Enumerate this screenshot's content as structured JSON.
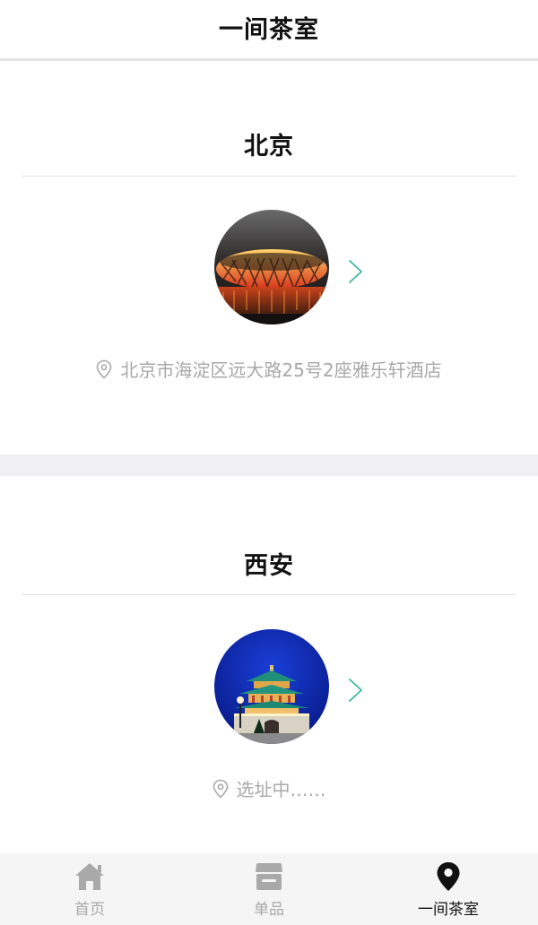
{
  "header": {
    "title": "一间茶室"
  },
  "locations": [
    {
      "city": "北京",
      "address": "北京市海淀区远大路25号2座雅乐轩酒店"
    },
    {
      "city": "西安",
      "address": "选址中……"
    }
  ],
  "tabbar": {
    "tabs": [
      {
        "label": "首页",
        "icon": "home-icon",
        "active": false
      },
      {
        "label": "单品",
        "icon": "shop-icon",
        "active": false
      },
      {
        "label": "一间茶室",
        "icon": "location-pin-icon",
        "active": true
      }
    ]
  },
  "colors": {
    "active_tab": "#111111",
    "inactive_tab": "#a9a9a9",
    "chevron": "#3fb8a0",
    "section_gap": "#efeff4"
  }
}
